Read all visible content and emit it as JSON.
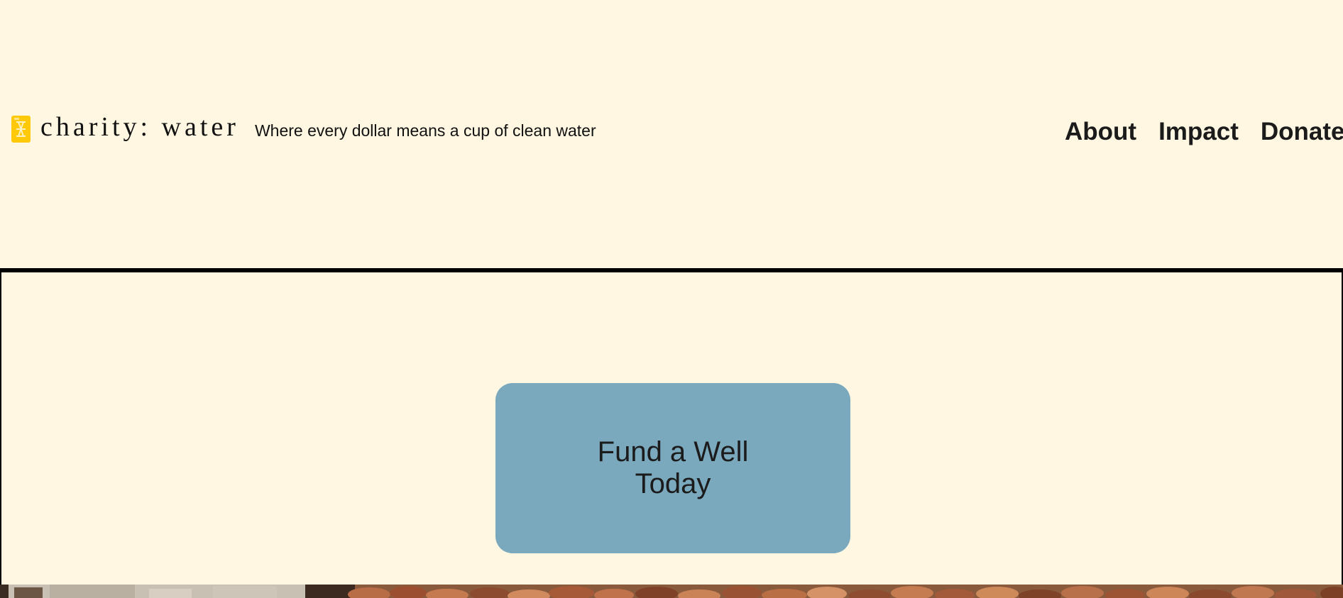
{
  "header": {
    "logo": {
      "icon": "jerry-can-icon",
      "text": "charity: water",
      "color": "#ffc907"
    },
    "tagline": "Where every dollar means a cup of clean water",
    "nav": [
      {
        "label": "About"
      },
      {
        "label": "Impact"
      },
      {
        "label": "Donate"
      }
    ]
  },
  "hero": {
    "cta_label": "Fund a Well Today",
    "cta_color": "#7aa8bc",
    "background_image": "rocky-ground-image"
  },
  "colors": {
    "background": "#fff7e1",
    "text": "#1b1b1b",
    "border": "#000000"
  }
}
